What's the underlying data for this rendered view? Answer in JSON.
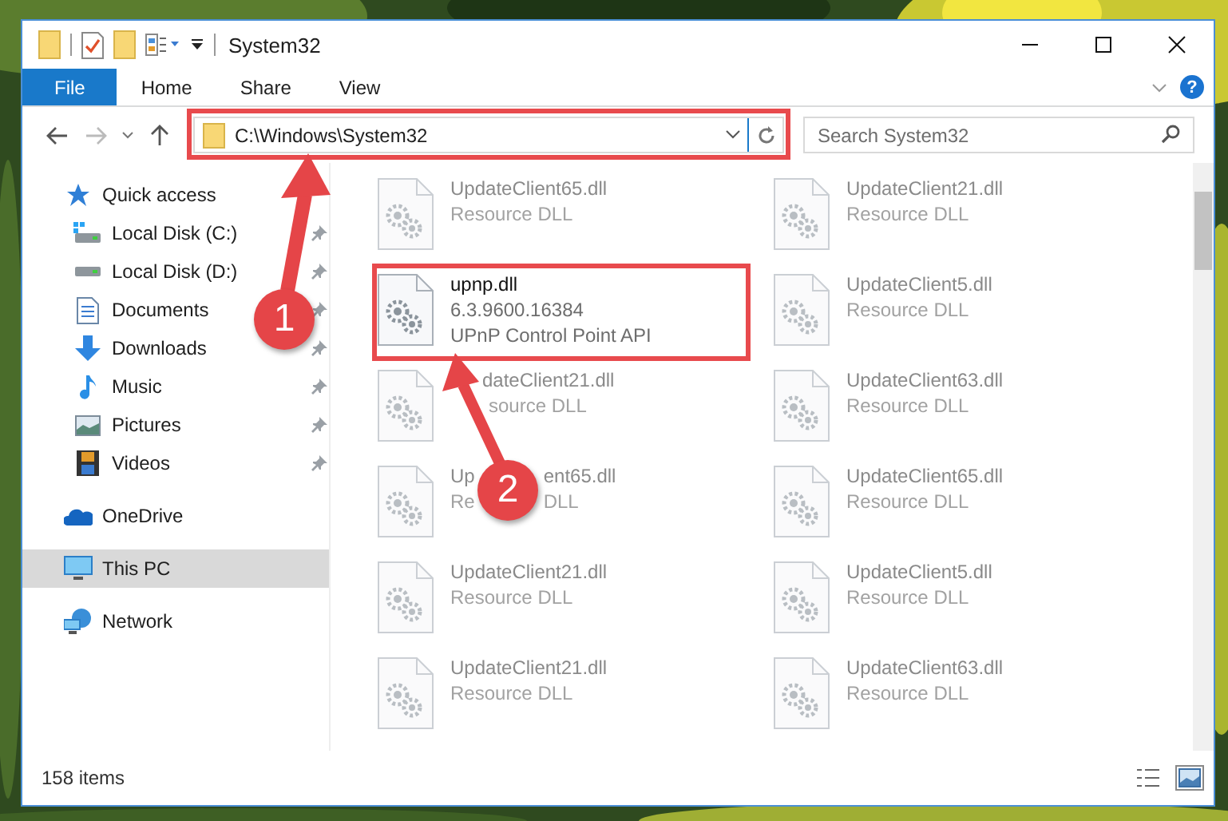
{
  "window": {
    "title": "System32"
  },
  "ribbon": {
    "tabs": [
      {
        "label": "File",
        "selected": true
      },
      {
        "label": "Home",
        "selected": false
      },
      {
        "label": "Share",
        "selected": false
      },
      {
        "label": "View",
        "selected": false
      }
    ],
    "help": "?"
  },
  "address": {
    "path": "C:\\Windows\\System32"
  },
  "search": {
    "placeholder": "Search System32"
  },
  "sidebar": {
    "items": [
      {
        "label": "Quick access",
        "selected": false,
        "children": [
          {
            "label": "Local Disk (C:)",
            "pinned": true,
            "selected": false
          },
          {
            "label": "Local Disk (D:)",
            "pinned": true,
            "selected": false
          },
          {
            "label": "Documents",
            "pinned": true,
            "selected": false
          },
          {
            "label": "Downloads",
            "pinned": true,
            "selected": false
          },
          {
            "label": "Music",
            "pinned": true,
            "selected": false
          },
          {
            "label": "Pictures",
            "pinned": true,
            "selected": false
          },
          {
            "label": "Videos",
            "pinned": true,
            "selected": false
          }
        ]
      },
      {
        "label": "OneDrive",
        "selected": false
      },
      {
        "label": "This PC",
        "selected": true
      },
      {
        "label": "Network",
        "selected": false
      }
    ]
  },
  "files": [
    {
      "name": [
        "UpdateClient65.dll"
      ],
      "lines": [
        [
          "Resource DLL"
        ]
      ],
      "highlighted": false
    },
    {
      "name": [
        "UpdateClient21.dll"
      ],
      "lines": [
        [
          "Resource DLL"
        ]
      ],
      "highlighted": false
    },
    {
      "name": [
        "upnp.dll"
      ],
      "lines": [
        [
          "6.3.9600.16384"
        ],
        [
          "UPnP Control Point API"
        ]
      ],
      "highlighted": true
    },
    {
      "name": [
        "UpdateClient5.dll"
      ],
      "lines": [
        [
          "Resource DLL"
        ]
      ],
      "highlighted": false
    },
    {
      "name": [
        "dateClient21.dll"
      ],
      "lines": [
        [
          "source DLL"
        ]
      ],
      "highlighted": false
    },
    {
      "name": [
        "UpdateClient63.dll"
      ],
      "lines": [
        [
          "Resource DLL"
        ]
      ],
      "highlighted": false
    },
    {
      "name": [
        "Up",
        "ent65.dll"
      ],
      "lines": [
        [
          "Re",
          "DLL"
        ]
      ],
      "highlighted": false
    },
    {
      "name": [
        "UpdateClient65.dll"
      ],
      "lines": [
        [
          "Resource DLL"
        ]
      ],
      "highlighted": false
    },
    {
      "name": [
        "UpdateClient21.dll"
      ],
      "lines": [
        [
          "Resource DLL"
        ]
      ],
      "highlighted": false
    },
    {
      "name": [
        "UpdateClient5.dll"
      ],
      "lines": [
        [
          "Resource DLL"
        ]
      ],
      "highlighted": false
    },
    {
      "name": [
        "UpdateClient21.dll"
      ],
      "lines": [
        [
          "Resource DLL"
        ]
      ],
      "highlighted": false
    },
    {
      "name": [
        "UpdateClient63.dll"
      ],
      "lines": [
        [
          "Resource DLL"
        ]
      ],
      "highlighted": false
    }
  ],
  "status_bar": {
    "count": "158 items",
    "views": [
      {
        "kind": "details",
        "selected": false
      },
      {
        "kind": "large",
        "selected": true
      }
    ]
  },
  "annotations": [
    {
      "label": "1"
    },
    {
      "label": "2"
    }
  ]
}
